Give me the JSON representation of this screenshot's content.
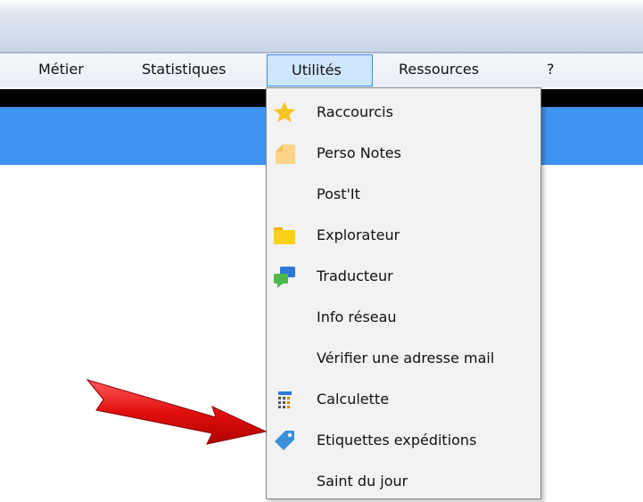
{
  "menubar": {
    "items": [
      {
        "label": "Métier",
        "active": false
      },
      {
        "label": "Statistiques",
        "active": false
      },
      {
        "label": "Utilités",
        "active": true
      },
      {
        "label": "Ressources",
        "active": false
      },
      {
        "label": "?",
        "active": false
      }
    ]
  },
  "dropdown": {
    "items": [
      {
        "label": "Raccourcis",
        "icon": "star-icon"
      },
      {
        "label": "Perso Notes",
        "icon": "note-icon"
      },
      {
        "label": "Post'It",
        "icon": null
      },
      {
        "label": "Explorateur",
        "icon": "folder-icon"
      },
      {
        "label": "Traducteur",
        "icon": "chat-bubbles-icon"
      },
      {
        "label": "Info réseau",
        "icon": null
      },
      {
        "label": "Vérifier une adresse mail",
        "icon": null
      },
      {
        "label": "Calculette",
        "icon": "calculator-icon"
      },
      {
        "label": "Etiquettes expéditions",
        "icon": "tag-icon"
      },
      {
        "label": "Saint du jour",
        "icon": null
      }
    ]
  },
  "colors": {
    "header_blue": "#3f92ee",
    "menu_active_bg": "#cfe6ff",
    "menu_active_border": "#3f8ae0",
    "arrow_red": "#e01010"
  }
}
